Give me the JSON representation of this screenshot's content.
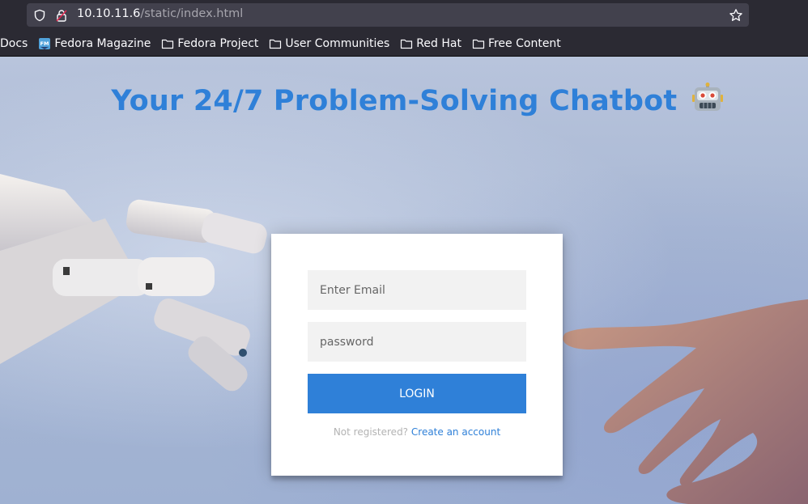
{
  "browser": {
    "url_host": "10.10.11.6",
    "url_path": "/static/index.html",
    "bookmarks": [
      {
        "label": "Docs",
        "icon": "none"
      },
      {
        "label": "Fedora Magazine",
        "icon": "fedora-magazine-icon"
      },
      {
        "label": "Fedora Project",
        "icon": "folder-icon"
      },
      {
        "label": "User Communities",
        "icon": "folder-icon"
      },
      {
        "label": "Red Hat",
        "icon": "folder-icon"
      },
      {
        "label": "Free Content",
        "icon": "folder-icon"
      }
    ]
  },
  "page": {
    "title": "Your 24/7 Problem-Solving Chatbot",
    "title_emoji": "robot-face-icon",
    "accent_color": "#2f80d8"
  },
  "login": {
    "email_placeholder": "Enter Email",
    "password_placeholder": "password",
    "login_label": "LOGIN",
    "not_registered": "Not registered?",
    "create_account": "Create an account"
  }
}
